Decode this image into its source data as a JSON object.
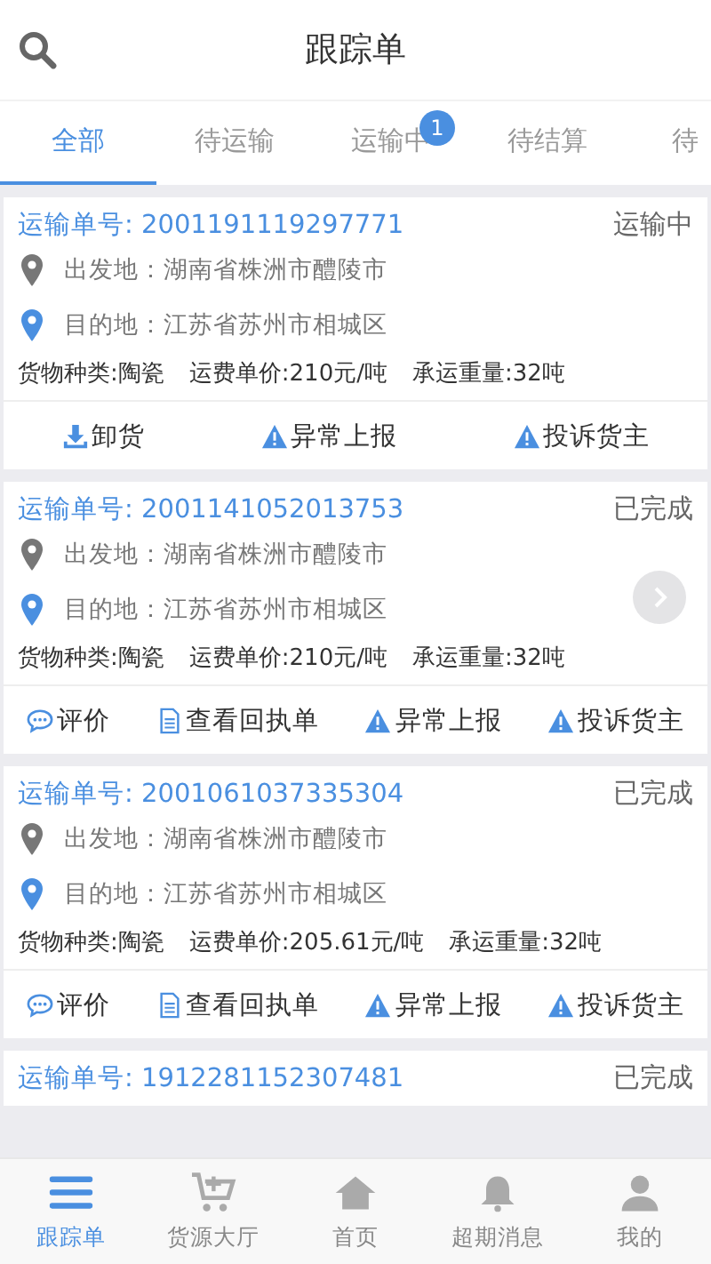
{
  "header": {
    "title": "跟踪单"
  },
  "tabs": [
    {
      "label": "全部",
      "selected": true
    },
    {
      "label": "待运输",
      "selected": false
    },
    {
      "label": "运输中",
      "selected": false,
      "badge": "1"
    },
    {
      "label": "待结算",
      "selected": false
    },
    {
      "label": "待",
      "selected": false
    }
  ],
  "orders": [
    {
      "number_label": "运输单号: 2001191119297771",
      "status": "运输中",
      "origin": "出发地：湖南省株洲市醴陵市",
      "destination": "目的地：江苏省苏州市相城区",
      "cargo": "货物种类:陶瓷",
      "price": "运费单价:210元/吨",
      "weight": "承运重量:32吨",
      "actions": [
        {
          "kind": "unload",
          "label": "卸货"
        },
        {
          "kind": "warning",
          "label": "异常上报"
        },
        {
          "kind": "warning",
          "label": "投诉货主"
        }
      ]
    },
    {
      "number_label": "运输单号: 2001141052013753",
      "status": "已完成",
      "origin": "出发地：湖南省株洲市醴陵市",
      "destination": "目的地：江苏省苏州市相城区",
      "cargo": "货物种类:陶瓷",
      "price": "运费单价:210元/吨",
      "weight": "承运重量:32吨",
      "next_button": true,
      "actions": [
        {
          "kind": "comment",
          "label": "评价"
        },
        {
          "kind": "document",
          "label": "查看回执单"
        },
        {
          "kind": "warning",
          "label": "异常上报"
        },
        {
          "kind": "warning",
          "label": "投诉货主"
        }
      ]
    },
    {
      "number_label": "运输单号: 2001061037335304",
      "status": "已完成",
      "origin": "出发地：湖南省株洲市醴陵市",
      "destination": "目的地：江苏省苏州市相城区",
      "cargo": "货物种类:陶瓷",
      "price": "运费单价:205.61元/吨",
      "weight": "承运重量:32吨",
      "actions": [
        {
          "kind": "comment",
          "label": "评价"
        },
        {
          "kind": "document",
          "label": "查看回执单"
        },
        {
          "kind": "warning",
          "label": "异常上报"
        },
        {
          "kind": "warning",
          "label": "投诉货主"
        }
      ]
    },
    {
      "number_label": "运输单号: 1912281152307481",
      "status": "已完成"
    }
  ],
  "bottom_nav": [
    {
      "kind": "menu",
      "label": "跟踪单",
      "selected": true
    },
    {
      "kind": "cart",
      "label": "货源大厅",
      "selected": false
    },
    {
      "kind": "home",
      "label": "首页",
      "selected": false
    },
    {
      "kind": "bell",
      "label": "超期消息",
      "selected": false
    },
    {
      "kind": "person",
      "label": "我的",
      "selected": false
    }
  ]
}
